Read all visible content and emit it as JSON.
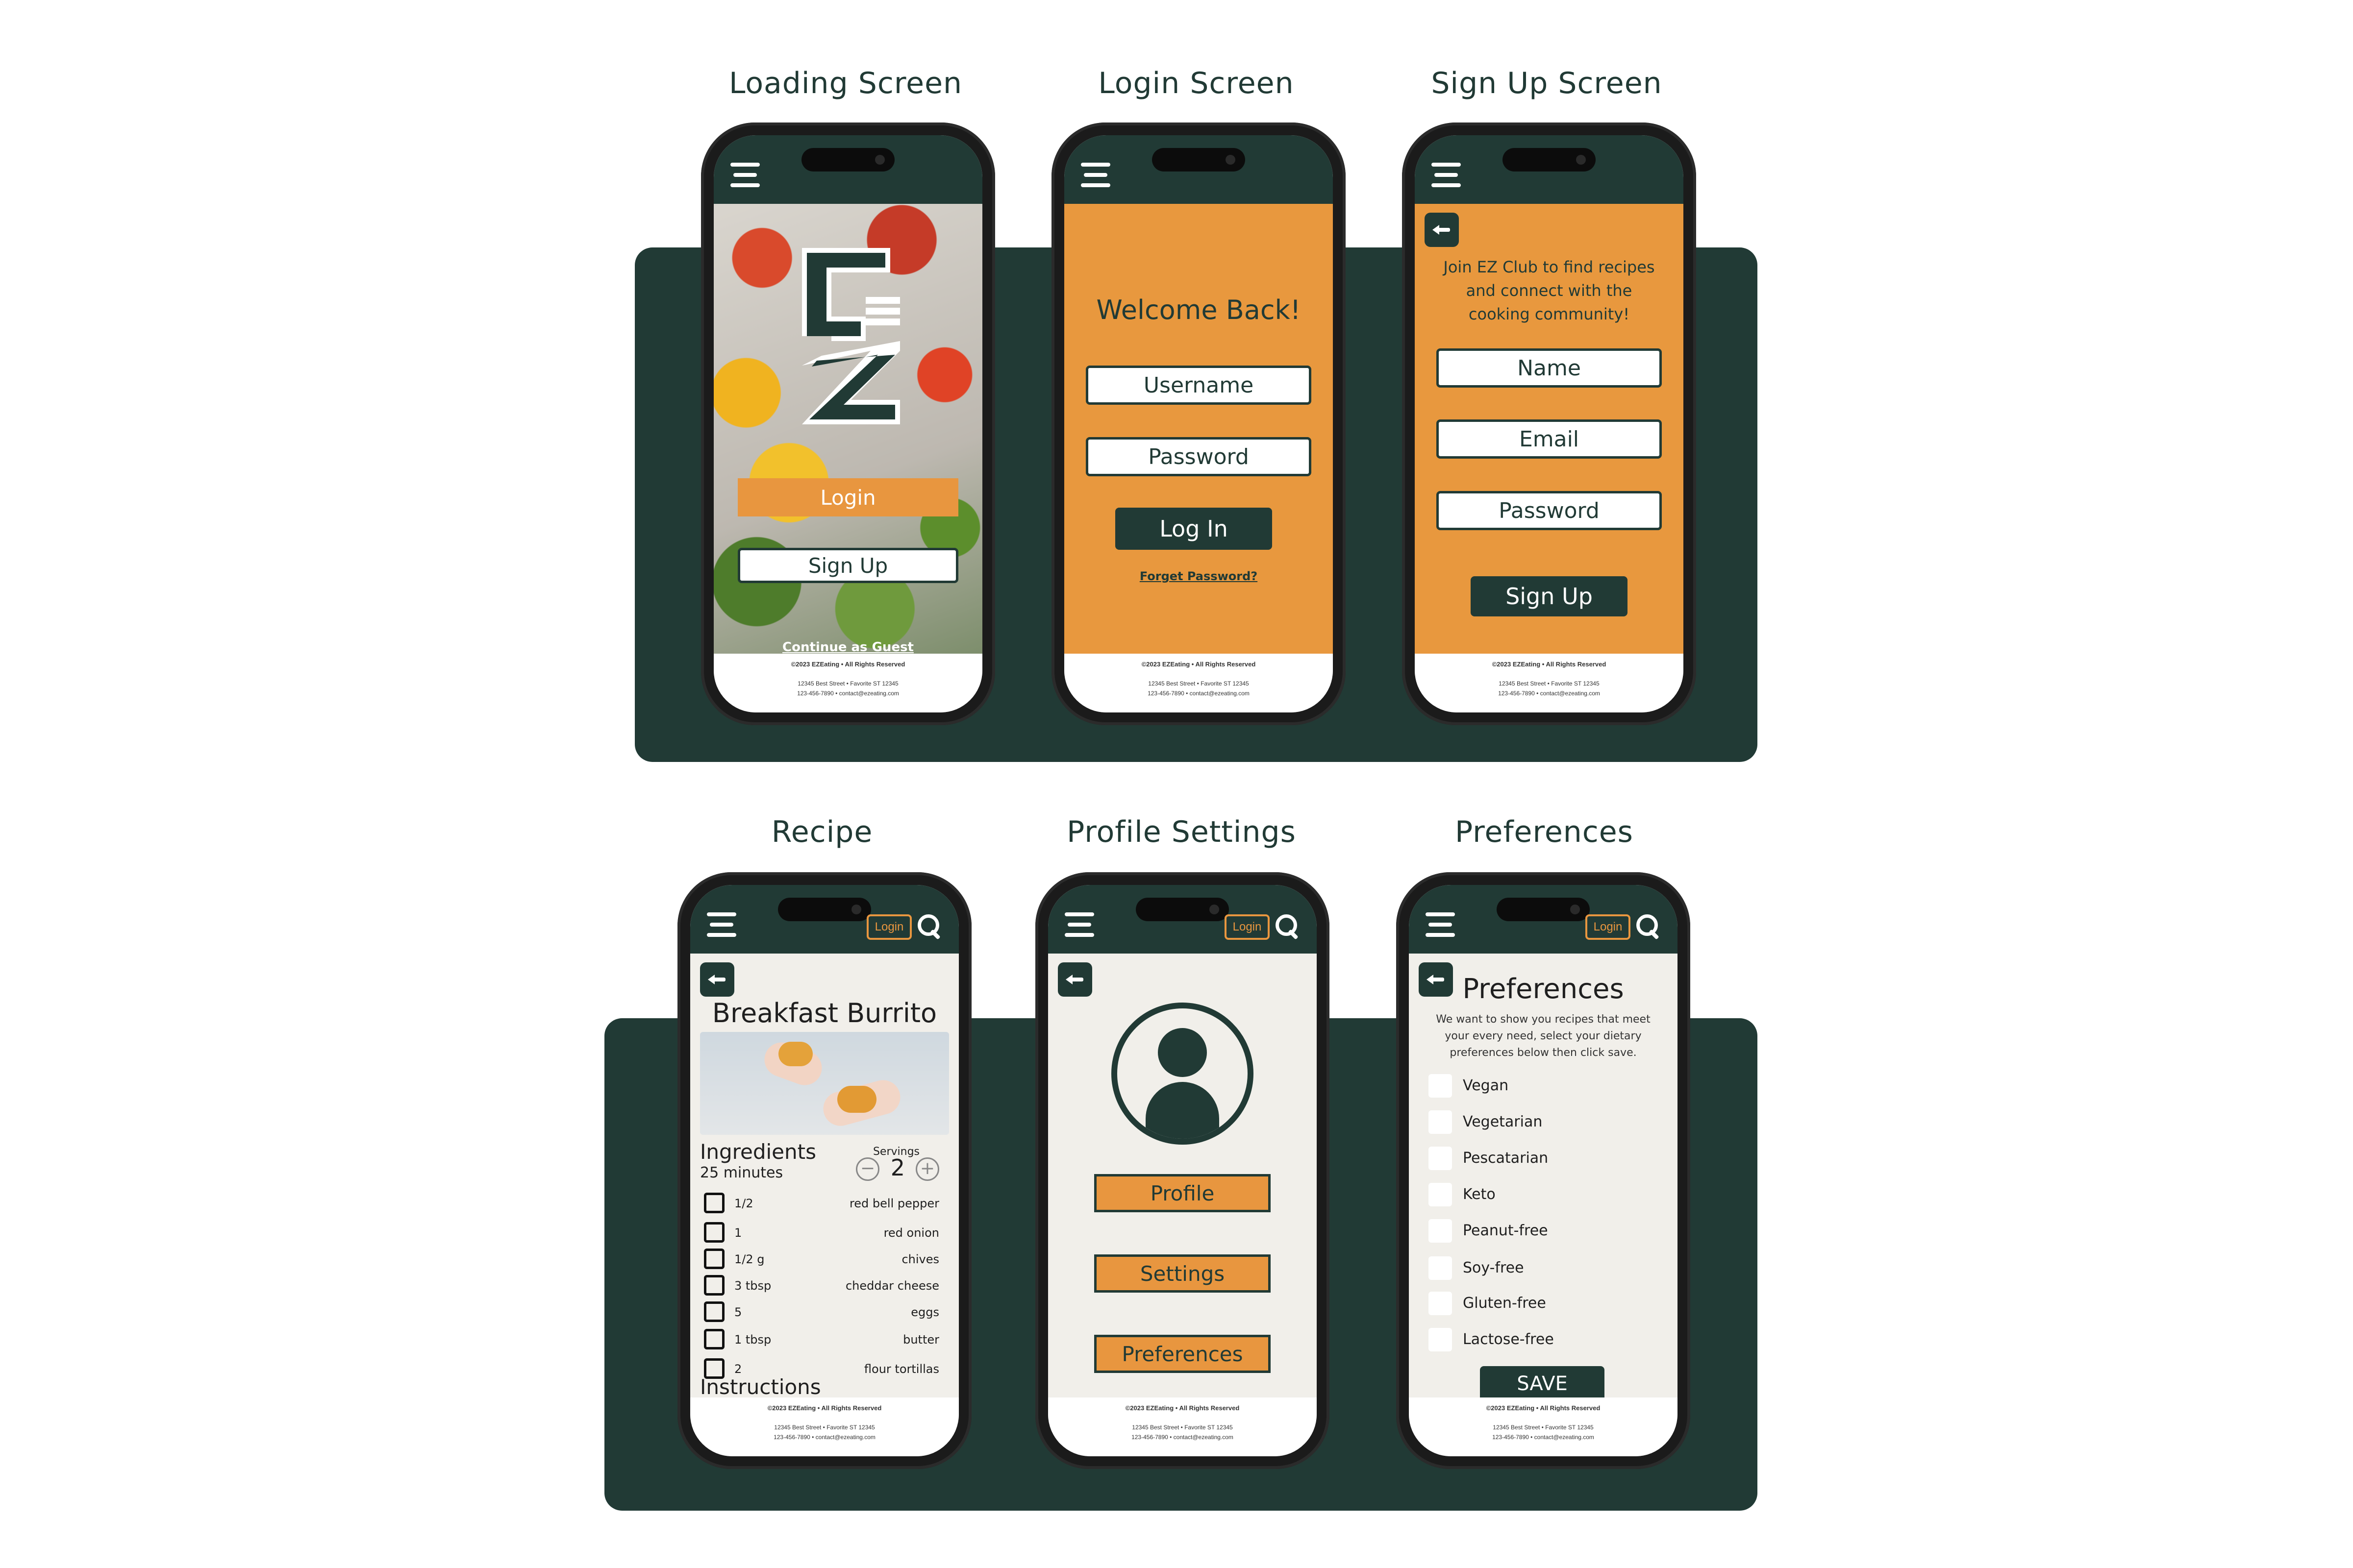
{
  "screens": {
    "loading": {
      "title": "Loading Screen",
      "login_label": "Login",
      "signup_label": "Sign Up",
      "guest_label": "Continue as Guest"
    },
    "login": {
      "title": "Login Screen",
      "heading": "Welcome Back!",
      "username_placeholder": "Username",
      "password_placeholder": "Password",
      "login_button": "Log In",
      "forgot_link": "Forget Password?"
    },
    "signup": {
      "title": "Sign Up Screen",
      "intro": "Join EZ Club to find recipes and connect with the cooking community!",
      "name_placeholder": "Name",
      "email_placeholder": "Email",
      "password_placeholder": "Password",
      "signup_button": "Sign Up"
    },
    "recipe": {
      "title": "Recipe",
      "recipe_name": "Breakfast Burrito",
      "ingredients_heading": "Ingredients",
      "time": "25 minutes",
      "servings_label": "Servings",
      "servings_value": "2",
      "minus": "−",
      "plus": "+",
      "ingredients": [
        {
          "qty": "1/2",
          "name": "red bell pepper"
        },
        {
          "qty": "1",
          "name": "red onion"
        },
        {
          "qty": "1/2 g",
          "name": "chives"
        },
        {
          "qty": "3 tbsp",
          "name": "cheddar cheese"
        },
        {
          "qty": "5",
          "name": "eggs"
        },
        {
          "qty": "1 tbsp",
          "name": "butter"
        },
        {
          "qty": "2",
          "name": "flour tortillas"
        }
      ],
      "instructions_heading": "Instructions"
    },
    "profile": {
      "title": "Profile Settings",
      "buttons": [
        "Profile",
        "Settings",
        "Preferences"
      ]
    },
    "preferences": {
      "title": "Preferences",
      "heading": "Preferences",
      "description": "We want to show you recipes that meet your every need, select your dietary preferences below then click save.",
      "options": [
        "Vegan",
        "Vegetarian",
        "Pescatarian",
        "Keto",
        "Peanut-free",
        "Soy-free",
        "Gluten-free",
        "Lactose-free"
      ],
      "save_button": "SAVE"
    }
  },
  "topbar": {
    "login_chip": "Login"
  },
  "footer": {
    "copyright": "©2023 EZEating • All Rights Reserved",
    "address": "12345 Best Street • Favorite ST 12345",
    "contact": "123-456-7890 • contact@ezeating.com"
  },
  "colors": {
    "dark_green": "#213a35",
    "orange": "#e8983e",
    "cream": "#f1efea"
  }
}
